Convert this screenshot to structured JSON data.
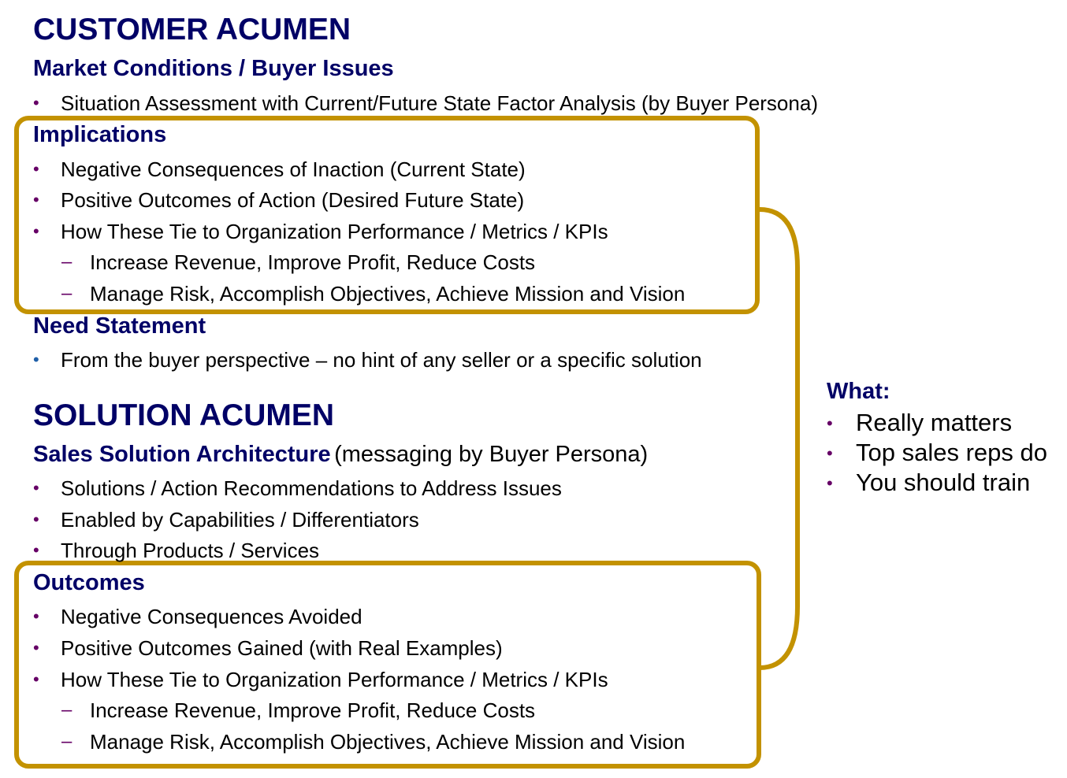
{
  "customer": {
    "title": "CUSTOMER ACUMEN",
    "market": {
      "heading": "Market Conditions / Buyer Issues",
      "items": [
        "Situation Assessment with Current/Future State Factor Analysis (by Buyer Persona)"
      ]
    },
    "implications": {
      "heading": "Implications",
      "items": [
        "Negative Consequences of Inaction (Current State)",
        "Positive Outcomes of Action (Desired Future State)",
        "How These Tie to Organization Performance / Metrics / KPIs"
      ],
      "subitems": [
        "Increase Revenue, Improve Profit, Reduce Costs",
        "Manage Risk, Accomplish Objectives, Achieve Mission and Vision"
      ]
    },
    "need": {
      "heading": "Need Statement",
      "items": [
        "From the buyer perspective – no hint of any seller or a specific solution"
      ]
    }
  },
  "solution": {
    "title": "SOLUTION ACUMEN",
    "architecture": {
      "heading": "Sales Solution Architecture",
      "heading_suffix": "(messaging by Buyer Persona)",
      "items": [
        "Solutions / Action Recommendations to Address Issues",
        "Enabled by Capabilities / Differentiators",
        "Through Products / Services"
      ]
    },
    "outcomes": {
      "heading": "Outcomes",
      "items": [
        "Negative Consequences Avoided",
        "Positive Outcomes Gained (with Real Examples)",
        "How These Tie to Organization Performance / Metrics / KPIs"
      ],
      "subitems": [
        "Increase Revenue, Improve Profit, Reduce Costs",
        "Manage Risk, Accomplish Objectives, Achieve Mission and Vision"
      ]
    }
  },
  "what": {
    "heading": "What:",
    "items": [
      "Really matters",
      "Top sales reps do",
      "You should train"
    ]
  },
  "symbols": {
    "bullet": "•",
    "dash": "–"
  },
  "colors": {
    "heading": "#000066",
    "bullet": "#660066",
    "need_bullet": "#1f5fa8",
    "box": "#c39200"
  }
}
